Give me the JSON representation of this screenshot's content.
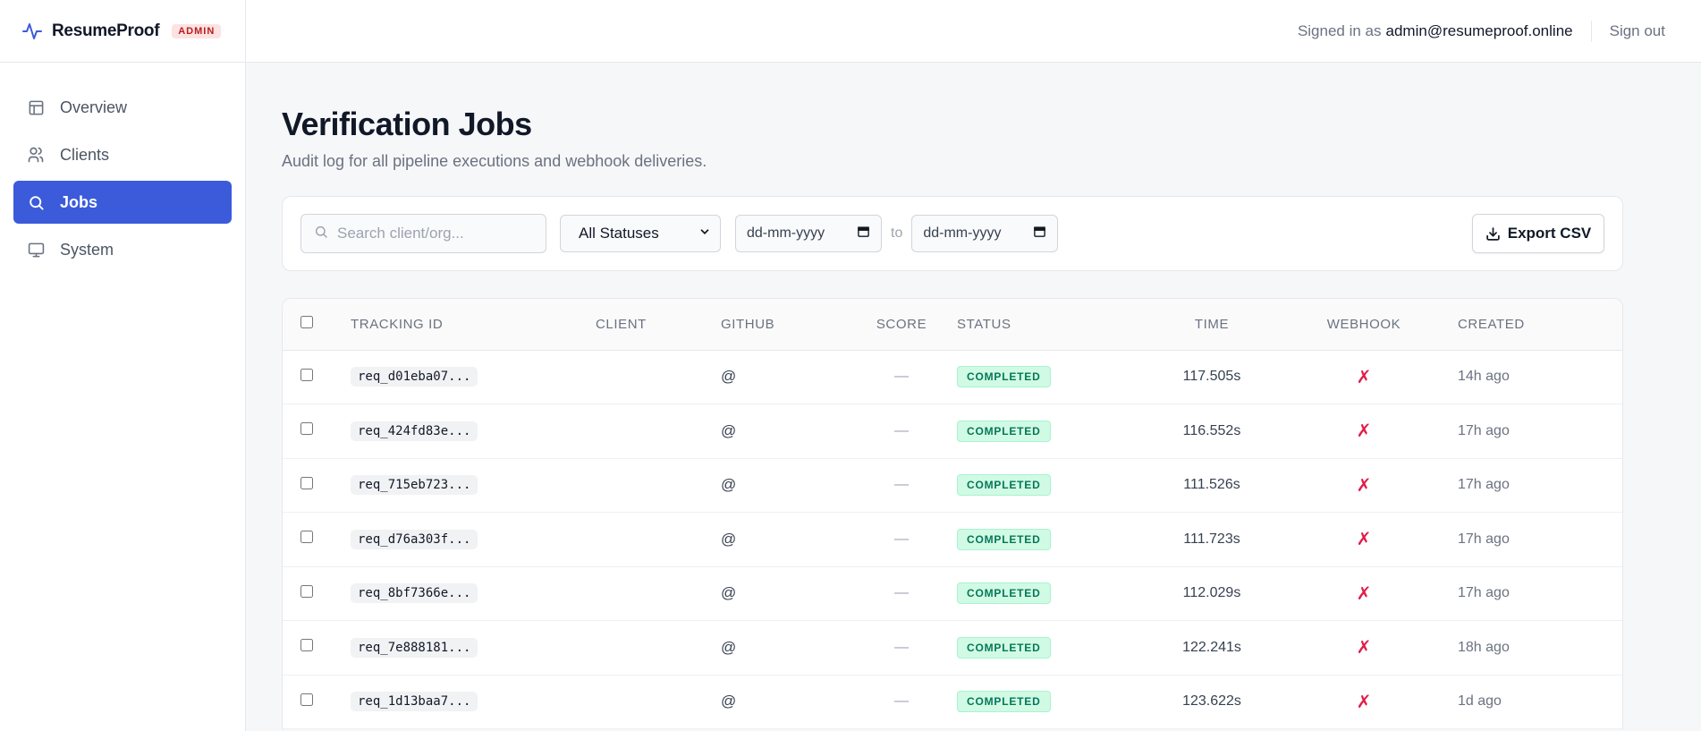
{
  "brand": {
    "name": "ResumeProof",
    "badge": "ADMIN",
    "accent": "#3b5bdb"
  },
  "nav": [
    {
      "label": "Overview",
      "icon": "layout-icon",
      "active": false
    },
    {
      "label": "Clients",
      "icon": "users-icon",
      "active": false
    },
    {
      "label": "Jobs",
      "icon": "search-icon",
      "active": true
    },
    {
      "label": "System",
      "icon": "monitor-icon",
      "active": false
    }
  ],
  "topbar": {
    "signed_in_label": "Signed in as",
    "email": "admin@resumeproof.online",
    "sign_out": "Sign out"
  },
  "page": {
    "title": "Verification Jobs",
    "subtitle": "Audit log for all pipeline executions and webhook deliveries."
  },
  "filters": {
    "search_placeholder": "Search client/org...",
    "status_selected": "All Statuses",
    "date_from_placeholder": "dd-mm-yyyy",
    "to_label": "to",
    "date_to_placeholder": "dd-mm-yyyy",
    "export_label": "Export CSV"
  },
  "table": {
    "headers": [
      "TRACKING ID",
      "CLIENT",
      "GITHUB",
      "SCORE",
      "STATUS",
      "TIME",
      "WEBHOOK",
      "CREATED"
    ],
    "rows": [
      {
        "id": "req_d01eba07...",
        "client": "",
        "github": "@",
        "score": "—",
        "status": "COMPLETED",
        "time": "117.505s",
        "webhook": "✗",
        "created": "14h ago"
      },
      {
        "id": "req_424fd83e...",
        "client": "",
        "github": "@",
        "score": "—",
        "status": "COMPLETED",
        "time": "116.552s",
        "webhook": "✗",
        "created": "17h ago"
      },
      {
        "id": "req_715eb723...",
        "client": "",
        "github": "@",
        "score": "—",
        "status": "COMPLETED",
        "time": "111.526s",
        "webhook": "✗",
        "created": "17h ago"
      },
      {
        "id": "req_d76a303f...",
        "client": "",
        "github": "@",
        "score": "—",
        "status": "COMPLETED",
        "time": "111.723s",
        "webhook": "✗",
        "created": "17h ago"
      },
      {
        "id": "req_8bf7366e...",
        "client": "",
        "github": "@",
        "score": "—",
        "status": "COMPLETED",
        "time": "112.029s",
        "webhook": "✗",
        "created": "17h ago"
      },
      {
        "id": "req_7e888181...",
        "client": "",
        "github": "@",
        "score": "—",
        "status": "COMPLETED",
        "time": "122.241s",
        "webhook": "✗",
        "created": "18h ago"
      },
      {
        "id": "req_1d13baa7...",
        "client": "",
        "github": "@",
        "score": "—",
        "status": "COMPLETED",
        "time": "123.622s",
        "webhook": "✗",
        "created": "1d ago"
      }
    ]
  }
}
